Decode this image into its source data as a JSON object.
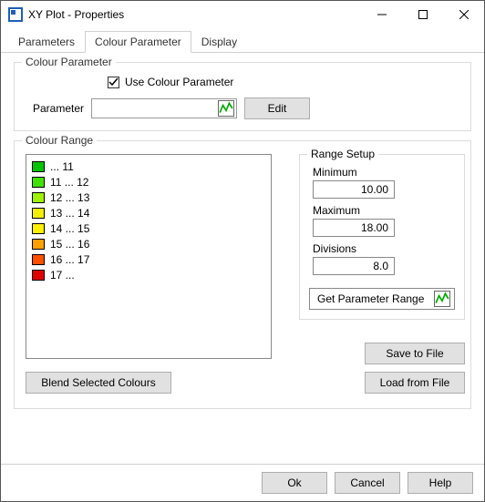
{
  "title": "XY Plot - Properties",
  "tabs": {
    "t0": "Parameters",
    "t1": "Colour Parameter",
    "t2": "Display"
  },
  "cp": {
    "legend": "Colour Parameter",
    "use_label": "Use Colour Parameter",
    "param_label": "Parameter",
    "edit": "Edit"
  },
  "cr": {
    "legend": "Colour Range",
    "items": [
      {
        "c": "#00c400",
        "t": " ... 11"
      },
      {
        "c": "#40e000",
        "t": "11 ... 12"
      },
      {
        "c": "#a0f000",
        "t": "12 ... 13"
      },
      {
        "c": "#f0f000",
        "t": "13 ... 14"
      },
      {
        "c": "#fff000",
        "t": "14 ... 15"
      },
      {
        "c": "#ffa000",
        "t": "15 ... 16"
      },
      {
        "c": "#ff5000",
        "t": "16 ... 17"
      },
      {
        "c": "#e00000",
        "t": "17 ... "
      }
    ],
    "blend": "Blend Selected Colours",
    "save": "Save to File",
    "load": "Load from File"
  },
  "rs": {
    "legend": "Range Setup",
    "min_l": "Minimum",
    "min_v": "10.00",
    "max_l": "Maximum",
    "max_v": "18.00",
    "div_l": "Divisions",
    "div_v": "8.0",
    "get": "Get Parameter Range"
  },
  "footer": {
    "ok": "Ok",
    "cancel": "Cancel",
    "help": "Help"
  }
}
